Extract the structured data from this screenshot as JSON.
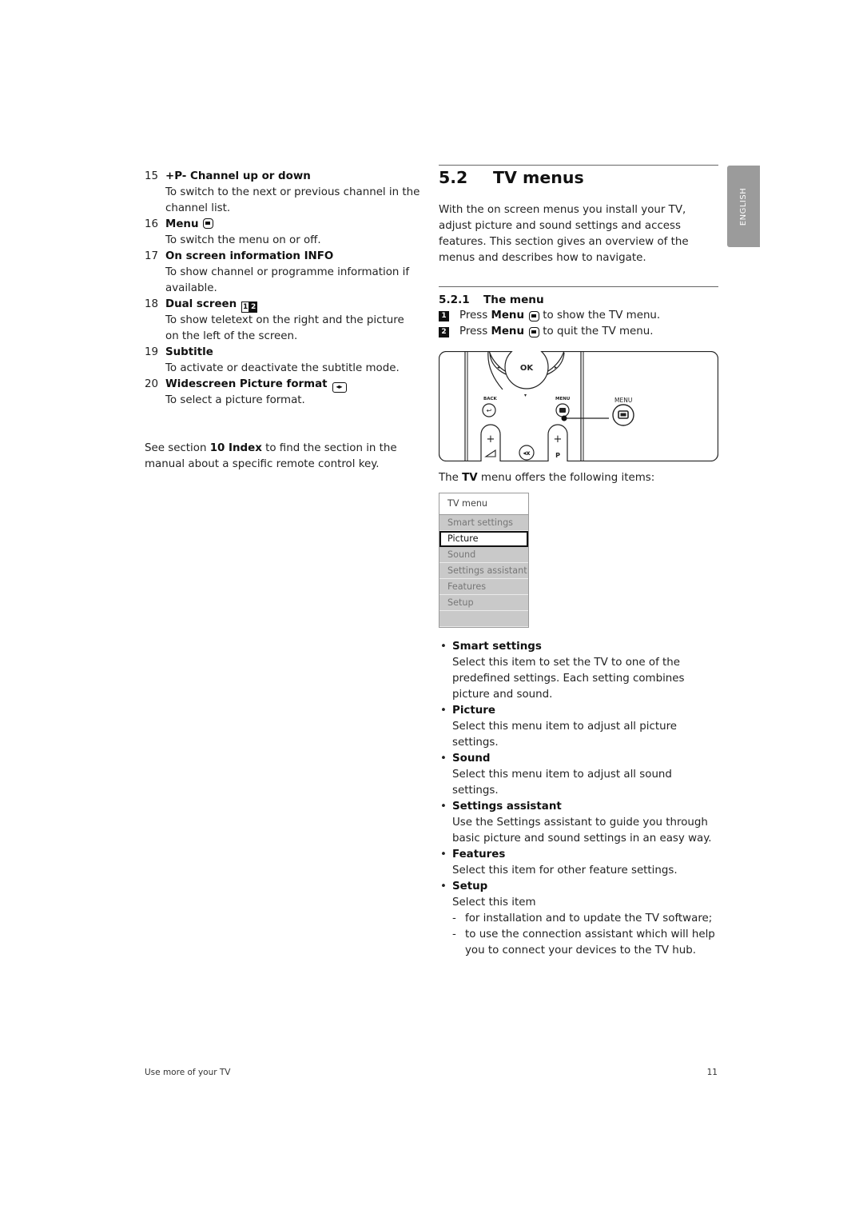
{
  "left_column": {
    "items": [
      {
        "num": "15",
        "title": "+P-  Channel up or down",
        "icon": "",
        "desc": "To switch to the next or previous channel in the channel list."
      },
      {
        "num": "16",
        "title": "Menu",
        "icon": "menu-key-icon",
        "desc": "To switch the menu on or off."
      },
      {
        "num": "17",
        "title": "On screen information INFO",
        "icon": "",
        "desc": "To show channel or programme information if available."
      },
      {
        "num": "18",
        "title": "Dual screen",
        "icon": "dual-screen-icon",
        "desc": "To show teletext on the right and the picture on the left of the screen."
      },
      {
        "num": "19",
        "title": "Subtitle",
        "icon": "",
        "desc": "To activate or deactivate the subtitle mode."
      },
      {
        "num": "20",
        "title": "Widescreen Picture format",
        "icon": "widescreen-icon",
        "desc": "To select a picture format."
      }
    ],
    "see_section": {
      "pre": "See section ",
      "ref": "10 Index",
      "post": " to find the section in the manual about a specific remote control key."
    }
  },
  "section": {
    "number": "5.2",
    "title": "TV menus",
    "intro": "With the on screen menus you install your TV, adjust picture and sound settings and access features. This section gives an overview of the menus and describes how to navigate."
  },
  "subsection": {
    "number": "5.2.1",
    "title": "The menu",
    "steps": [
      {
        "badge": "1",
        "pre": "Press ",
        "key": "Menu",
        "post": " to show the TV menu."
      },
      {
        "badge": "2",
        "pre": "Press ",
        "key": "Menu",
        "post": " to quit the TV menu."
      }
    ]
  },
  "remote_illustration": {
    "ok_label": "OK",
    "back_label": "BACK",
    "menu_label_small": "MENU",
    "menu_label_callout": "MENU",
    "program_label": "P",
    "plus_symbol": "+"
  },
  "caption": {
    "pre": "The ",
    "bold": "TV",
    "post": " menu offers the following items:"
  },
  "tv_menu": {
    "title": "TV menu",
    "items": [
      "Smart settings",
      "Picture",
      "Sound",
      "Settings assistant",
      "Features",
      "Setup"
    ],
    "selected": "Picture"
  },
  "descriptions": [
    {
      "title": "Smart settings",
      "text": "Select this item to set the TV to one of the predefined settings. Each setting combines picture and sound."
    },
    {
      "title": "Picture",
      "text": "Select this menu item to adjust all picture settings."
    },
    {
      "title": "Sound",
      "text": "Select this menu item to adjust all sound settings."
    },
    {
      "title": "Settings assistant",
      "text": "Use the Settings assistant to guide you through basic picture and sound settings in an easy way."
    },
    {
      "title": "Features",
      "text": "Select this item for other feature settings."
    },
    {
      "title": "Setup",
      "text": "Select this item"
    }
  ],
  "setup_subitems": [
    "for installation and to update the TV software;",
    "to use the connection assistant which will help you to connect your devices to the TV hub."
  ],
  "language_tab": "ENGLISH",
  "footer": {
    "left": "Use more of your TV",
    "page": "11"
  }
}
